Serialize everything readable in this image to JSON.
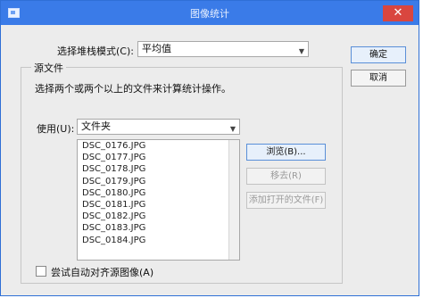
{
  "window": {
    "title": "图像统计",
    "close_label": "✕"
  },
  "stack_mode": {
    "label": "选择堆栈模式(C):",
    "value": "平均值"
  },
  "buttons": {
    "ok": "确定",
    "cancel": "取消",
    "browse": "浏览(B)...",
    "remove": "移去(R)",
    "add_open": "添加打开的文件(F)"
  },
  "source": {
    "group_title": "源文件",
    "description": "选择两个或两个以上的文件来计算统计操作。",
    "use_label": "使用(U):",
    "use_value": "文件夹",
    "files": [
      "DSC_0176.JPG",
      "DSC_0177.JPG",
      "DSC_0178.JPG",
      "DSC_0179.JPG",
      "DSC_0180.JPG",
      "DSC_0181.JPG",
      "DSC_0182.JPG",
      "DSC_0183.JPG",
      "DSC_0184.JPG"
    ]
  },
  "align_checkbox": {
    "label": "尝试自动对齐源图像(A)",
    "checked": false
  }
}
